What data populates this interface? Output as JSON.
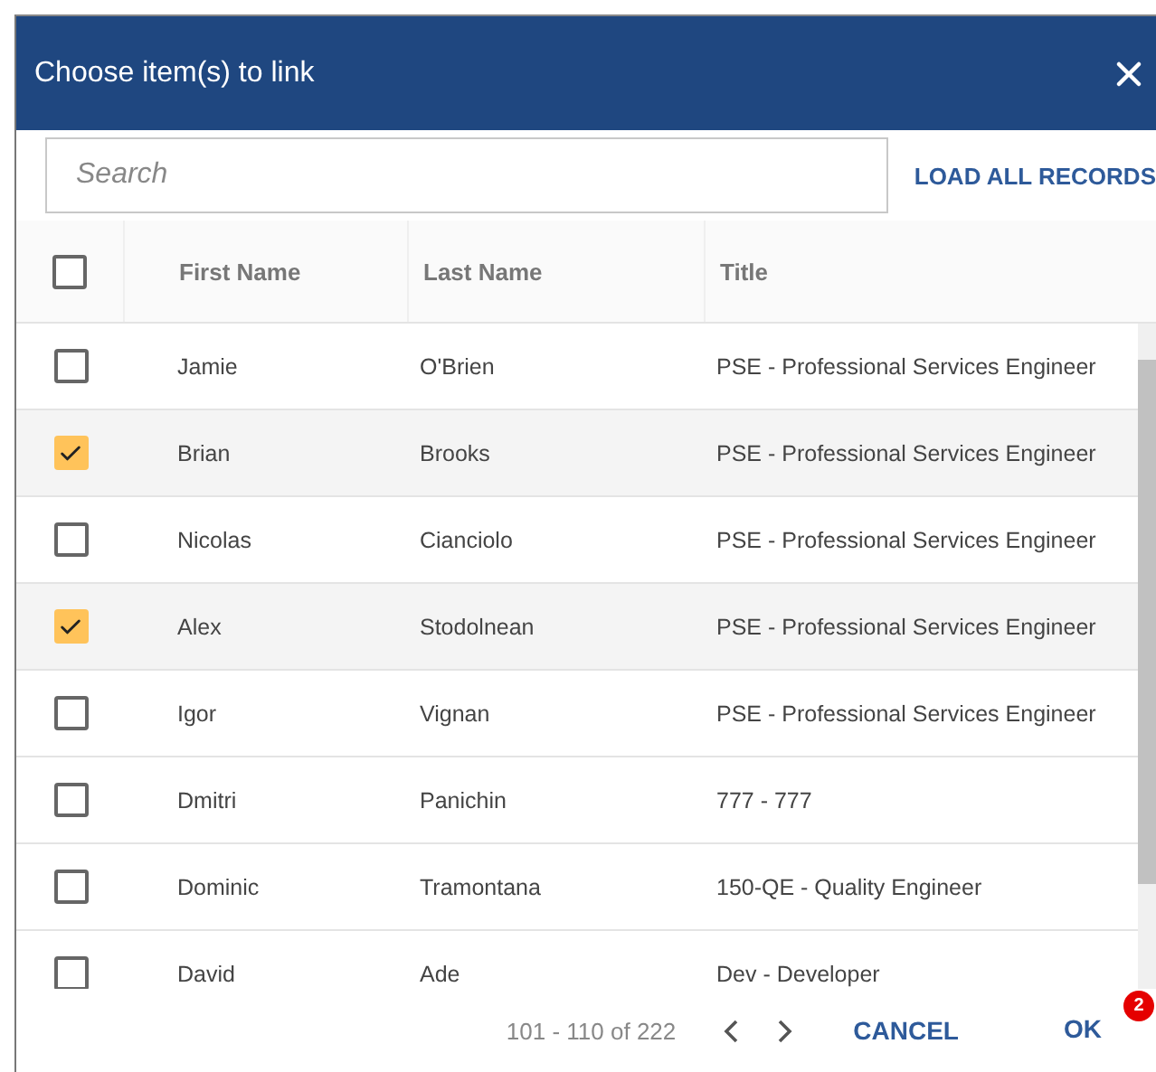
{
  "dialog": {
    "title": "Choose item(s) to link"
  },
  "search": {
    "placeholder": "Search"
  },
  "load_all_button": "LOAD ALL RECORDS",
  "table": {
    "select_all": {
      "checked": false
    },
    "columns": [
      "First Name",
      "Last Name",
      "Title"
    ],
    "rows": [
      {
        "first": "Jamie",
        "last": "O'Brien",
        "title": "PSE - Professional Services Engineer",
        "checked": false
      },
      {
        "first": "Brian",
        "last": "Brooks",
        "title": "PSE - Professional Services Engineer",
        "checked": true
      },
      {
        "first": "Nicolas",
        "last": "Cianciolo",
        "title": "PSE - Professional Services Engineer",
        "checked": false
      },
      {
        "first": "Alex",
        "last": "Stodolnean",
        "title": "PSE - Professional Services Engineer",
        "checked": true
      },
      {
        "first": "Igor",
        "last": "Vignan",
        "title": "PSE - Professional Services Engineer",
        "checked": false
      },
      {
        "first": "Dmitri",
        "last": "Panichin",
        "title": "777 - 777",
        "checked": false
      },
      {
        "first": "Dominic",
        "last": "Tramontana",
        "title": "150-QE - Quality Engineer",
        "checked": false
      },
      {
        "first": "David",
        "last": "Ade",
        "title": "Dev - Developer",
        "checked": false
      }
    ]
  },
  "footer": {
    "range": "101 - 110 of 222",
    "cancel": "CANCEL",
    "ok": "OK",
    "ok_badge": "2"
  }
}
